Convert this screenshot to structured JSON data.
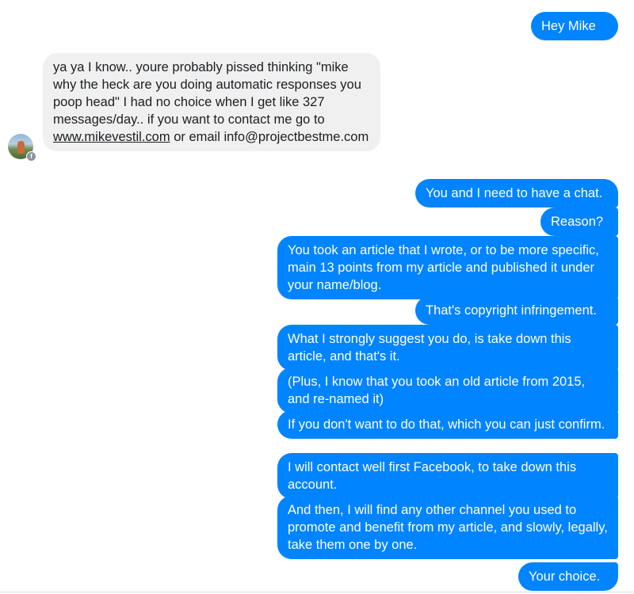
{
  "messages": {
    "m1": "Hey Mike",
    "in_part1": "ya ya I know.. youre probably pissed thinking \"mike why the heck are you doing automatic responses you poop head\" I had no choice when I get like 327 messages/day.. if you want to contact me go to ",
    "in_link": "www.mikevestil.com",
    "in_part2": "  or email info@projectbestme.com",
    "m2": "You and I need to have a chat.",
    "m3": "Reason?",
    "m4": "You took an article that I wrote, or to be more specific, main 13 points from my article and published it under your name/blog.",
    "m5": "That's copyright infringement.",
    "m6": "What I strongly suggest you do, is take down this article, and that's it.",
    "m7": "(Plus, I know that you took an old article from 2015, and re-named it)",
    "m8": "If you don't want to do that, which you can just confirm.",
    "m9": "I will contact well first Facebook, to take down this account.",
    "m10": "And then, I will find any other channel you used to promote and benefit from my article, and slowly, legally, take them one by one.",
    "m11": "Your choice."
  },
  "icons": {
    "avatar": "avatar",
    "badge": "facebook-icon",
    "badge_glyph": "f"
  },
  "colors": {
    "outgoing_bubble": "#0084ff",
    "incoming_bubble": "#f0f0f0"
  }
}
